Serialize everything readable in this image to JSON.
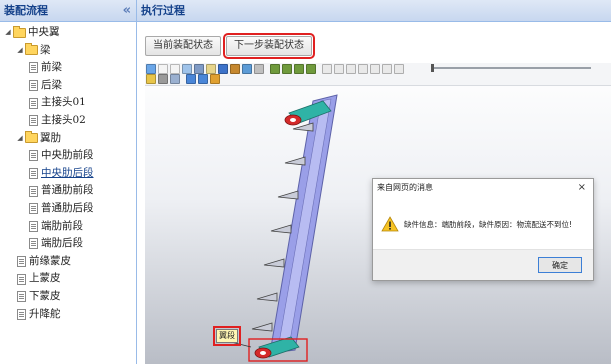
{
  "left_panel": {
    "title": "装配流程",
    "collapse_glyph": "«",
    "tree": [
      {
        "label": "中央翼",
        "type": "folder",
        "depth": 0,
        "expanded": true
      },
      {
        "label": "梁",
        "type": "folder",
        "depth": 1,
        "expanded": true
      },
      {
        "label": "前梁",
        "type": "doc",
        "depth": 2
      },
      {
        "label": "后梁",
        "type": "doc",
        "depth": 2
      },
      {
        "label": "主接头01",
        "type": "doc",
        "depth": 2
      },
      {
        "label": "主接头02",
        "type": "doc",
        "depth": 2
      },
      {
        "label": "翼肋",
        "type": "folder",
        "depth": 1,
        "expanded": true
      },
      {
        "label": "中央肋前段",
        "type": "doc",
        "depth": 2
      },
      {
        "label": "中央肋后段",
        "type": "doc",
        "depth": 2,
        "selected": true
      },
      {
        "label": "普通肋前段",
        "type": "doc",
        "depth": 2
      },
      {
        "label": "普通肋后段",
        "type": "doc",
        "depth": 2
      },
      {
        "label": "端肋前段",
        "type": "doc",
        "depth": 2
      },
      {
        "label": "端肋后段",
        "type": "doc",
        "depth": 2
      },
      {
        "label": "前缘蒙皮",
        "type": "doc",
        "depth": 1
      },
      {
        "label": "上蒙皮",
        "type": "doc",
        "depth": 1
      },
      {
        "label": "下蒙皮",
        "type": "doc",
        "depth": 1
      },
      {
        "label": "升降舵",
        "type": "doc",
        "depth": 1
      }
    ]
  },
  "right_panel": {
    "title": "执行过程",
    "buttons": {
      "current_state": "当前装配状态",
      "next_state": "下一步装配状态"
    },
    "viewer": {
      "callout_label": "翼段"
    }
  },
  "dialog": {
    "title": "来自网页的消息",
    "close_glyph": "×",
    "message": "缺件信息：端肋前段，缺件原因：物流配送不到位!",
    "ok_label": "确定"
  },
  "colors": {
    "accent": "#15428b",
    "highlight_red": "#e02020",
    "model_purple": "#9a9fe8",
    "model_teal": "#2fb3a6"
  }
}
